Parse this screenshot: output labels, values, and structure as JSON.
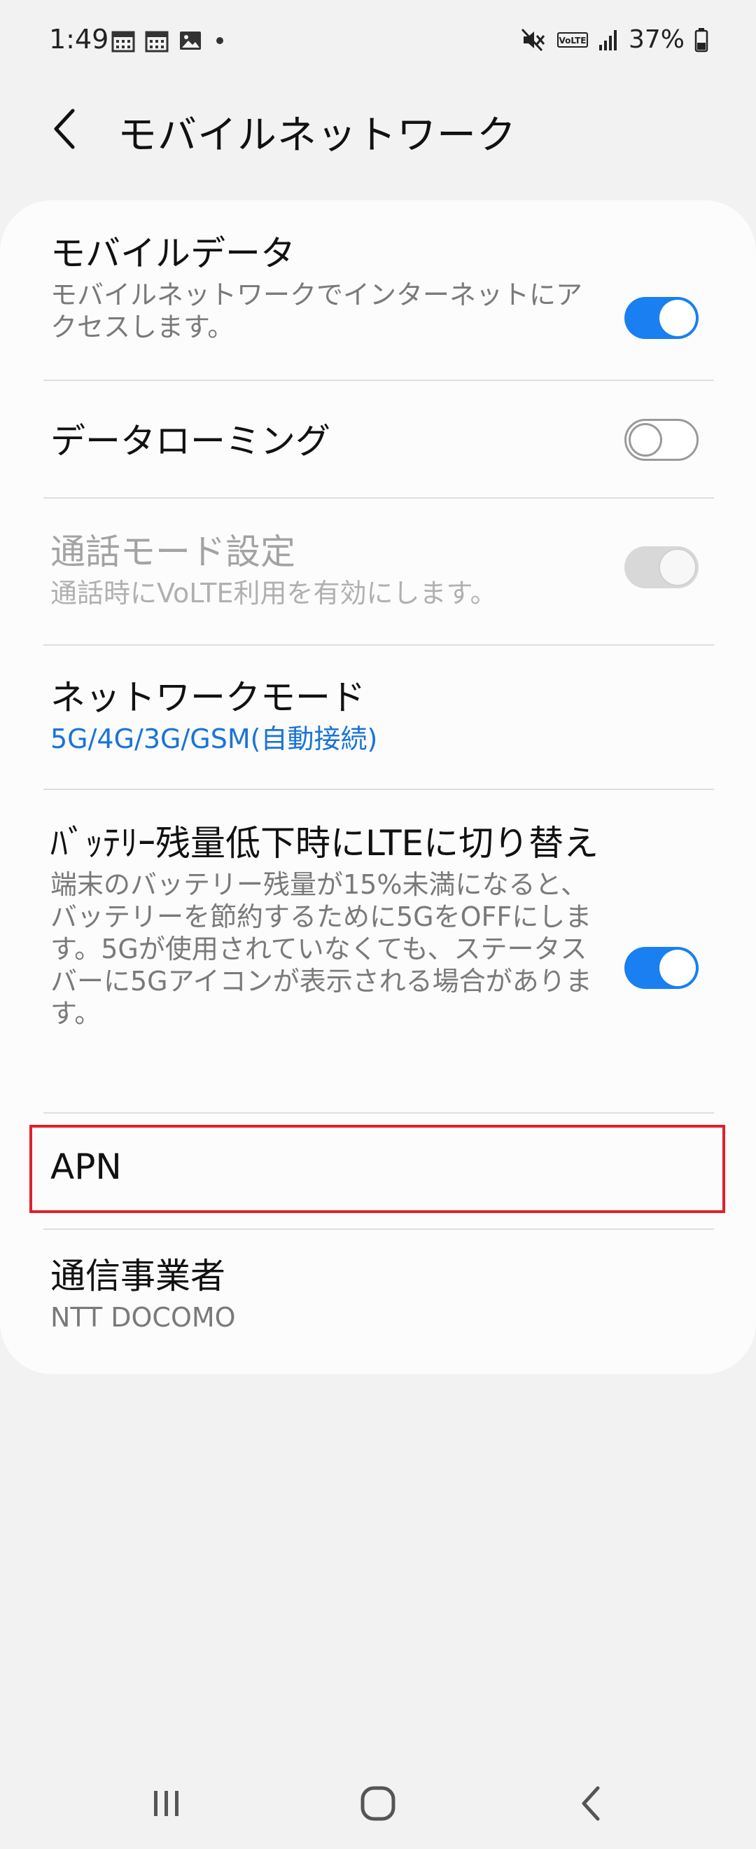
{
  "status_bar": {
    "time": "1:49",
    "battery_percent": "37%",
    "icons": [
      "calendar-icon",
      "calendar-icon",
      "image-icon",
      "dot-icon",
      "mute-icon",
      "volte-icon",
      "signal-icon",
      "battery-icon"
    ]
  },
  "header": {
    "title": "モバイルネットワーク",
    "back_icon": "back-chevron-icon"
  },
  "settings": [
    {
      "title": "モバイルデータ",
      "subtitle": "モバイルネットワークでインターネットにアクセスします。",
      "toggle": true
    },
    {
      "title": "データローミング",
      "toggle": false
    },
    {
      "title": "通話モード設定",
      "subtitle": "通話時にVoLTE利用を有効にします。",
      "toggle": true,
      "disabled": true
    },
    {
      "title": "ネットワークモード",
      "subtitle": "5G/4G/3G/GSM(自動接続)"
    },
    {
      "title": "ﾊﾞｯﾃﾘｰ残量低下時にLTEに切り替え",
      "subtitle": "端末のバッテリー残量が15%未満になると、バッテリーを節約するために5GをOFFにします。5Gが使用されていなくても、ステータスバーに5Gアイコンが表示される場合があります。",
      "toggle": true
    },
    {
      "title": "APN",
      "highlighted": true
    },
    {
      "title": "通信事業者",
      "subtitle": "NTT DOCOMO"
    }
  ],
  "colors": {
    "accent": "#1a7ff0",
    "link_text": "#1a73d9",
    "highlight": "#e0202a",
    "background": "#f2f2f2",
    "card": "#fcfcfc"
  },
  "nav_bar": {
    "icons": [
      "recent-apps-icon",
      "home-icon",
      "back-icon"
    ]
  }
}
